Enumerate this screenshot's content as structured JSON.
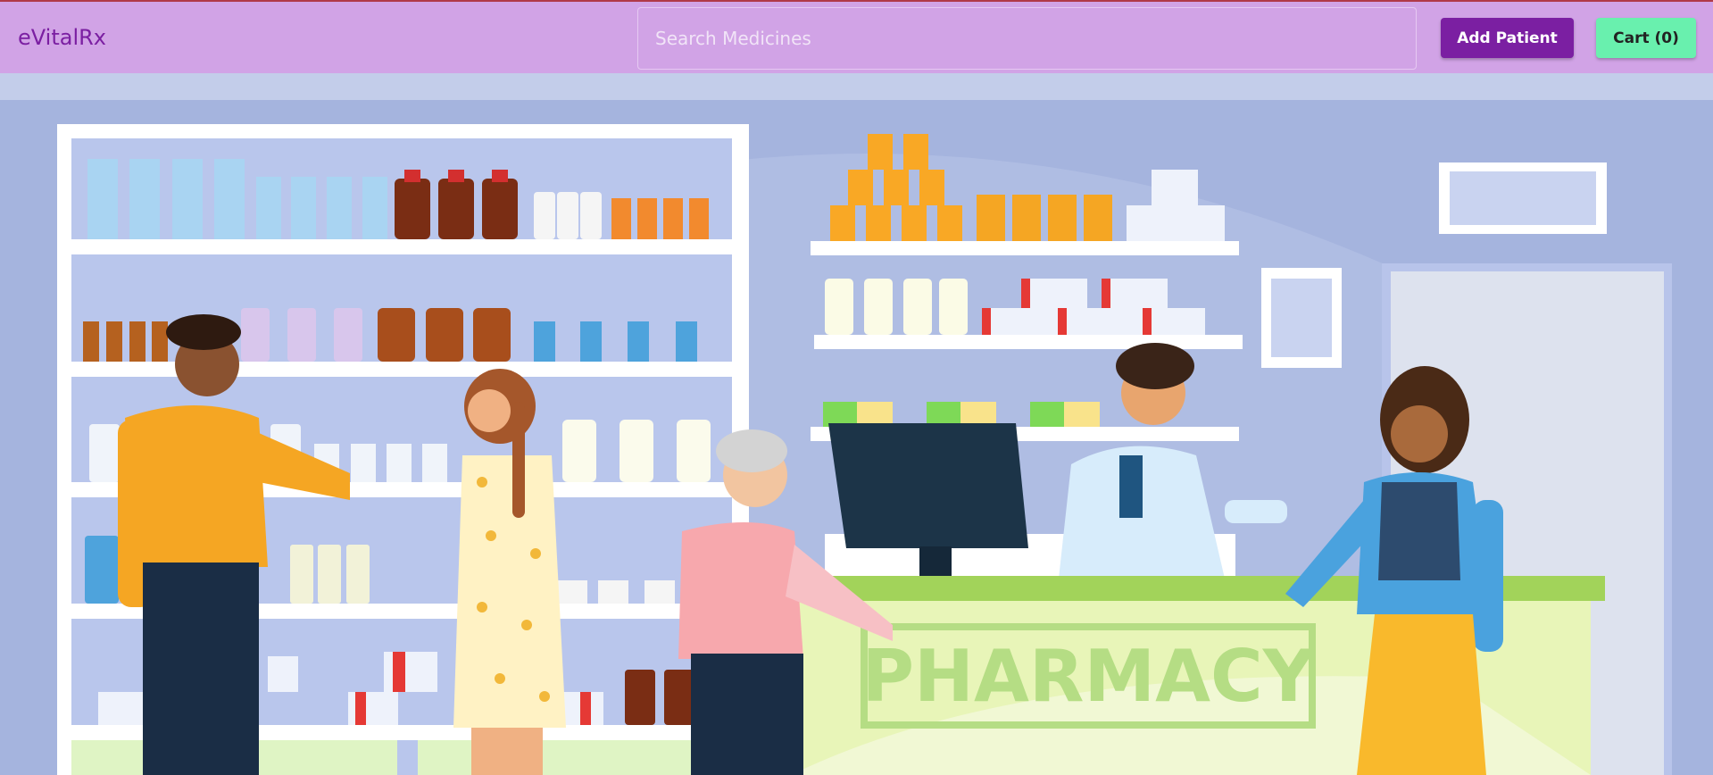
{
  "navbar": {
    "brand": "eVitalRx",
    "search_placeholder": "Search Medicines",
    "add_patient_label": "Add Patient",
    "cart_label": "Cart (0)"
  },
  "hero": {
    "sign_text": "PHARMACY"
  },
  "colors": {
    "navbar_bg": "#d1a3e6",
    "brand": "#7b1fa2",
    "add_patient_bg": "#7b1fa2",
    "cart_bg": "#69f0ae",
    "wall": "#a5b4de",
    "counter": "#e8f5b8",
    "sign": "#b5dd84"
  }
}
